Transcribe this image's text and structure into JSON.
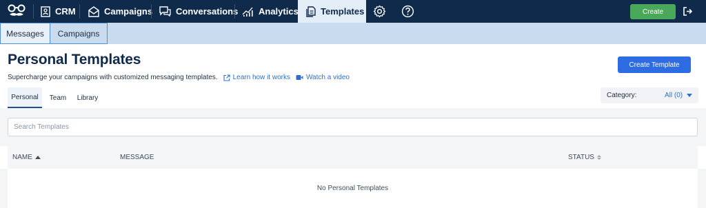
{
  "topnav": {
    "items": [
      {
        "label": "CRM",
        "icon": "contact-card-icon"
      },
      {
        "label": "Campaigns",
        "icon": "mail-icon"
      },
      {
        "label": "Conversations",
        "icon": "chat-icon"
      },
      {
        "label": "Analytics",
        "icon": "bar-chart-icon"
      },
      {
        "label": "Templates",
        "icon": "document-icon",
        "active": true
      }
    ],
    "create_label": "Create"
  },
  "subnav": {
    "tabs": [
      {
        "label": "Messages",
        "active": true
      },
      {
        "label": "Campaigns"
      }
    ]
  },
  "header": {
    "title": "Personal Templates",
    "subtitle": "Supercharge your campaigns with customized messaging templates.",
    "learn_link": "Learn how it works",
    "video_link": "Watch a video",
    "create_template_label": "Create Template"
  },
  "tabs": [
    "Personal",
    "Team",
    "Library"
  ],
  "category": {
    "label": "Category:",
    "value": "All (0)"
  },
  "search": {
    "placeholder": "Search Templates",
    "value": ""
  },
  "table": {
    "columns": [
      "NAME",
      "MESSAGE",
      "STATUS"
    ],
    "empty_text": "No Personal Templates"
  },
  "colors": {
    "nav_bg": "#0f2a4a",
    "subnav_bg": "#c9dbef",
    "create_green": "#4aa85a",
    "primary_blue": "#2d6ce2",
    "link_blue": "#2f6fcb"
  }
}
